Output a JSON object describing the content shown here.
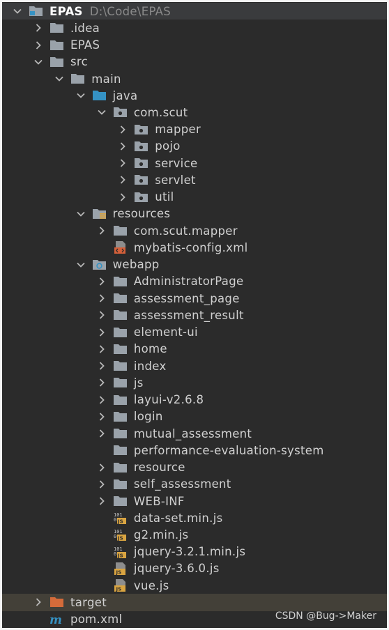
{
  "project": {
    "name": "EPAS",
    "path": "D:\\Code\\EPAS"
  },
  "colors": {
    "background": "#2b2b2b",
    "text": "#d0d0d0",
    "folder": "#9aa2aa",
    "source_folder": "#3592c4",
    "excluded_folder": "#d46b3a",
    "js_badge": "#d9a441"
  },
  "tree": [
    {
      "label": ".idea",
      "icon": "folder-icon",
      "expand": "collapsed"
    },
    {
      "label": "EPAS",
      "icon": "folder-icon",
      "expand": "collapsed"
    },
    {
      "label": "src",
      "icon": "folder-icon",
      "expand": "expanded"
    },
    {
      "label": "main",
      "icon": "folder-icon",
      "expand": "expanded"
    },
    {
      "label": "java",
      "icon": "source-folder-icon",
      "expand": "expanded"
    },
    {
      "label": "com.scut",
      "icon": "package-icon",
      "expand": "expanded"
    },
    {
      "label": "mapper",
      "icon": "package-icon",
      "expand": "collapsed"
    },
    {
      "label": "pojo",
      "icon": "package-icon",
      "expand": "collapsed"
    },
    {
      "label": "service",
      "icon": "package-icon",
      "expand": "collapsed"
    },
    {
      "label": "servlet",
      "icon": "package-icon",
      "expand": "collapsed"
    },
    {
      "label": "util",
      "icon": "package-icon",
      "expand": "collapsed"
    },
    {
      "label": "resources",
      "icon": "resources-folder-icon",
      "expand": "expanded"
    },
    {
      "label": "com.scut.mapper",
      "icon": "folder-icon",
      "expand": "collapsed"
    },
    {
      "label": "mybatis-config.xml",
      "icon": "xml-file-icon",
      "expand": "none"
    },
    {
      "label": "webapp",
      "icon": "web-folder-icon",
      "expand": "expanded"
    },
    {
      "label": "AdministratorPage",
      "icon": "folder-icon",
      "expand": "collapsed"
    },
    {
      "label": "assessment_page",
      "icon": "folder-icon",
      "expand": "collapsed"
    },
    {
      "label": "assessment_result",
      "icon": "folder-icon",
      "expand": "collapsed"
    },
    {
      "label": "element-ui",
      "icon": "folder-icon",
      "expand": "collapsed"
    },
    {
      "label": "home",
      "icon": "folder-icon",
      "expand": "collapsed"
    },
    {
      "label": "index",
      "icon": "folder-icon",
      "expand": "collapsed"
    },
    {
      "label": "js",
      "icon": "folder-icon",
      "expand": "collapsed"
    },
    {
      "label": "layui-v2.6.8",
      "icon": "folder-icon",
      "expand": "collapsed"
    },
    {
      "label": "login",
      "icon": "folder-icon",
      "expand": "collapsed"
    },
    {
      "label": "mutual_assessment",
      "icon": "folder-icon",
      "expand": "collapsed"
    },
    {
      "label": "performance-evaluation-system",
      "icon": "folder-icon",
      "expand": "none"
    },
    {
      "label": "resource",
      "icon": "folder-icon",
      "expand": "collapsed"
    },
    {
      "label": "self_assessment",
      "icon": "folder-icon",
      "expand": "collapsed"
    },
    {
      "label": "WEB-INF",
      "icon": "folder-icon",
      "expand": "collapsed"
    },
    {
      "label": "data-set.min.js",
      "icon": "minified-js-file-icon",
      "expand": "none"
    },
    {
      "label": "g2.min.js",
      "icon": "minified-js-file-icon",
      "expand": "none"
    },
    {
      "label": "jquery-3.2.1.min.js",
      "icon": "minified-js-file-icon",
      "expand": "none"
    },
    {
      "label": "jquery-3.6.0.js",
      "icon": "js-file-icon",
      "expand": "none"
    },
    {
      "label": "vue.js",
      "icon": "js-file-icon",
      "expand": "none"
    },
    {
      "label": "target",
      "icon": "excluded-folder-icon",
      "expand": "collapsed",
      "selected": true
    },
    {
      "label": "pom.xml",
      "icon": "maven-file-icon",
      "expand": "none"
    }
  ],
  "watermark": "CSDN @Bug->Maker"
}
